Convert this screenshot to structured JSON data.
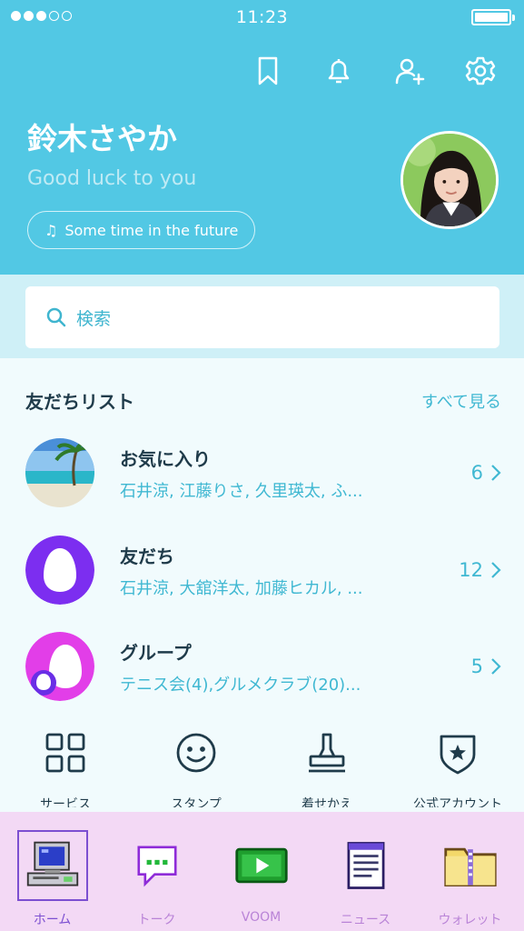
{
  "status_bar": {
    "time": "11:23",
    "signal_strength": 3,
    "signal_max": 5,
    "battery_level": 1.0
  },
  "header": {
    "name": "鈴木さやか",
    "status_message": "Good luck to you",
    "music": "Some time in the future",
    "icons": [
      "bookmark-icon",
      "bell-icon",
      "add-friend-icon",
      "gear-icon"
    ]
  },
  "search": {
    "placeholder": "検索"
  },
  "friends": {
    "title": "友だちリスト",
    "see_all": "すべて見る",
    "rows": [
      {
        "name": "お気に入り",
        "members": "石井涼, 江藤りさ, 久里瑛太, ふ...",
        "count": "6"
      },
      {
        "name": "友だち",
        "members": "石井涼, 大舘洋太, 加藤ヒカル, ...",
        "count": "12"
      },
      {
        "name": "グループ",
        "members": "テニス会(4),グルメクラブ(20)...",
        "count": "5"
      }
    ]
  },
  "services": [
    {
      "label": "サービス",
      "icon": "grid-icon"
    },
    {
      "label": "スタンプ",
      "icon": "smiley-icon"
    },
    {
      "label": "着せかえ",
      "icon": "stamp-icon"
    },
    {
      "label": "公式アカウント",
      "icon": "shield-star-icon"
    }
  ],
  "tabs": [
    {
      "label": "ホーム",
      "icon": "computer-icon",
      "active": true
    },
    {
      "label": "トーク",
      "icon": "chat-bubble-icon",
      "active": false
    },
    {
      "label": "VOOM",
      "icon": "video-play-icon",
      "active": false
    },
    {
      "label": "ニュース",
      "icon": "notepad-icon",
      "active": false
    },
    {
      "label": "ウォレット",
      "icon": "zip-folder-icon",
      "active": false
    }
  ],
  "colors": {
    "header": "#52c8e4",
    "accent": "#40b8d2",
    "tabbar": "#f3d9f5",
    "tab_active": "#7c4fd1"
  }
}
